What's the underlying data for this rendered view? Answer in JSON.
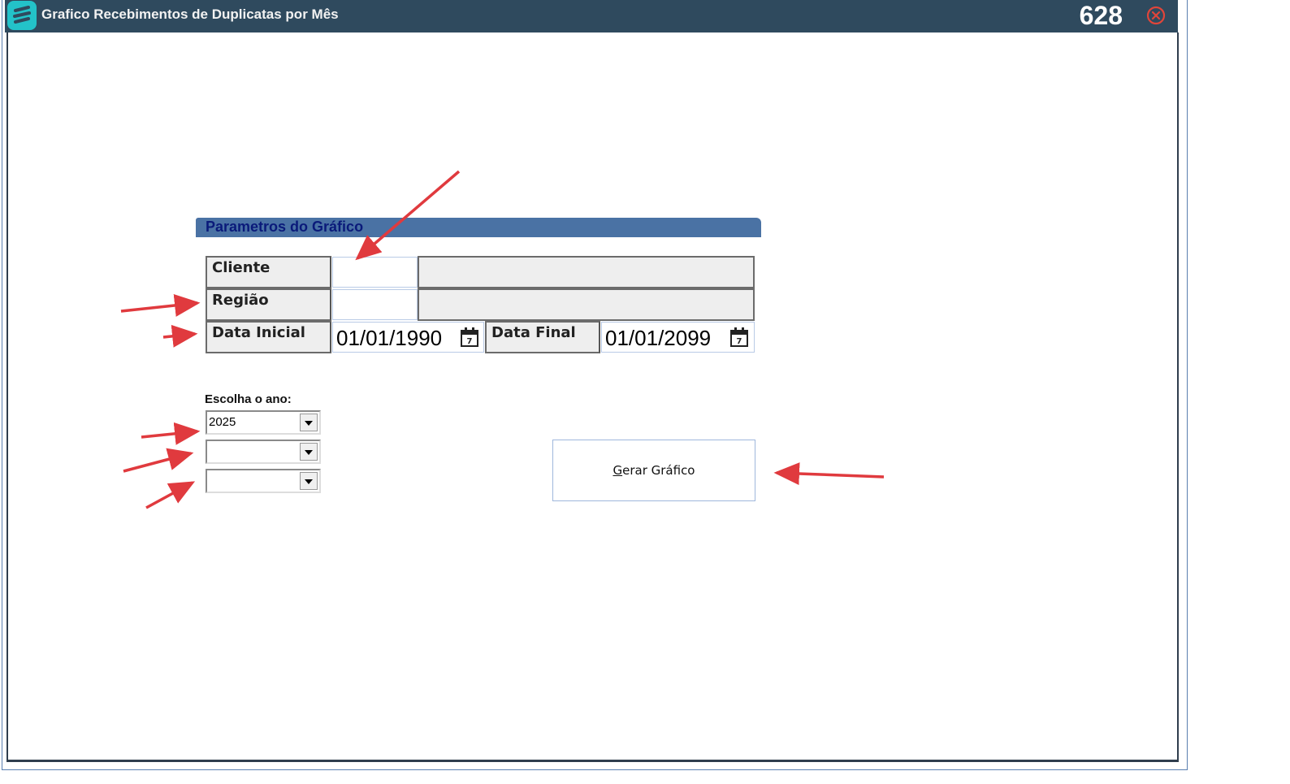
{
  "window": {
    "title": "Grafico Recebimentos de Duplicatas por Mês",
    "code": "628"
  },
  "params": {
    "section_title": "Parametros do Gráfico",
    "cliente_label": "Cliente",
    "cliente_code": "",
    "cliente_name": "",
    "regiao_label": "Região",
    "regiao_code": "",
    "regiao_name": "",
    "data_inicial_label": "Data Inicial",
    "data_inicial_value": "01/01/1990",
    "data_final_label": "Data Final",
    "data_final_value": "01/01/2099"
  },
  "year": {
    "label": "Escolha o ano:",
    "select1": "2025",
    "select2": "",
    "select3": ""
  },
  "actions": {
    "generate_prefix": "G",
    "generate_rest": "erar Gráfico"
  },
  "colors": {
    "titlebar": "#2f4a5e",
    "section_header": "#4a72a4",
    "annotation_arrow": "#e03a3e"
  }
}
